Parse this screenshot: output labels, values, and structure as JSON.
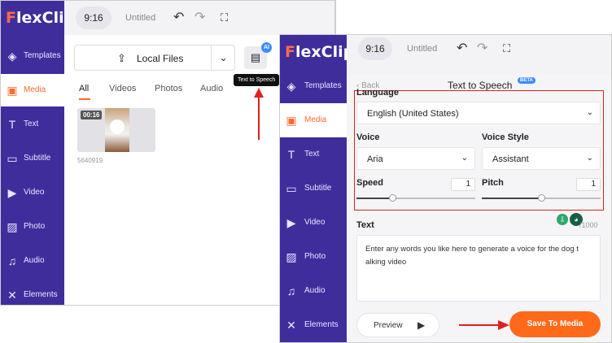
{
  "brand": {
    "logo_f": "F",
    "logo_rest": "lexClip"
  },
  "left": {
    "aspect": "9:16",
    "title": "Untitled",
    "sidebar": [
      {
        "label": "Templates",
        "icon": "layers-icon"
      },
      {
        "label": "Media",
        "icon": "media-icon"
      },
      {
        "label": "Text",
        "icon": "text-icon"
      },
      {
        "label": "Subtitle",
        "icon": "subtitle-icon"
      },
      {
        "label": "Video",
        "icon": "video-icon"
      },
      {
        "label": "Photo",
        "icon": "photo-icon"
      },
      {
        "label": "Audio",
        "icon": "audio-icon"
      },
      {
        "label": "Elements",
        "icon": "elements-icon"
      }
    ],
    "local_files": "Local Files",
    "ai_badge": "AI",
    "tooltip": "Text to Speech",
    "tabs": [
      "All",
      "Videos",
      "Photos",
      "Audio"
    ],
    "thumb_duration": "00:16",
    "thumb_name": "5640919"
  },
  "right": {
    "aspect": "9:16",
    "title": "Untitled",
    "sidebar": [
      {
        "label": "Templates"
      },
      {
        "label": "Media"
      },
      {
        "label": "Text"
      },
      {
        "label": "Subtitle"
      },
      {
        "label": "Video"
      },
      {
        "label": "Photo"
      },
      {
        "label": "Audio"
      },
      {
        "label": "Elements"
      }
    ],
    "back": "Back",
    "panel_title": "Text to Speech",
    "beta": "BETA",
    "language_label": "Language",
    "language_value": "English (United States)",
    "voice_label": "Voice",
    "voice_value": "Aria",
    "style_label": "Voice Style",
    "style_value": "Assistant",
    "speed_label": "Speed",
    "speed_value": "1",
    "speed_level": 0.3,
    "pitch_label": "Pitch",
    "pitch_value": "1",
    "pitch_level": 0.5,
    "text_label": "Text",
    "counter": "/1000",
    "text_value": "Enter any words you like here to generate a voice for the dog t alking video",
    "preview": "Preview",
    "save": "Save To Media"
  },
  "colors": {
    "sidebar": "#3f2d9c",
    "accent": "#ff6a1a",
    "highlight_box": "#e02020"
  }
}
